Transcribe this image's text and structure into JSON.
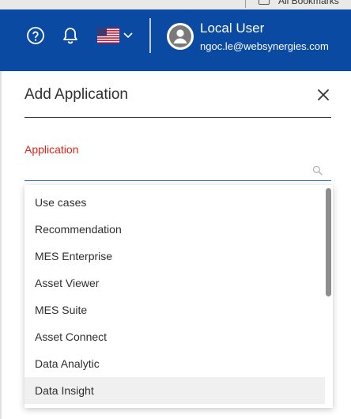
{
  "browser": {
    "bookmarks_label": "All Bookmarks"
  },
  "header": {
    "background_color": "#0b4aa2",
    "icons": [
      "help-icon",
      "bell-icon",
      "us-flag-icon",
      "chevron-down-icon"
    ],
    "user": {
      "name": "Local User",
      "email": "ngoc.le@websynergies.com"
    }
  },
  "dialog": {
    "title": "Add Application",
    "close_icon": "close-icon",
    "field": {
      "label": "Application",
      "label_color": "#e0241b",
      "value": "",
      "placeholder": "",
      "icon": "search-icon"
    },
    "options": [
      {
        "label": "Use cases"
      },
      {
        "label": "Recommendation"
      },
      {
        "label": "MES Enterprise"
      },
      {
        "label": "Asset Viewer"
      },
      {
        "label": "MES Suite"
      },
      {
        "label": "Asset Connect"
      },
      {
        "label": "Data Analytic"
      },
      {
        "label": "Data Insight",
        "hovered": true
      }
    ]
  }
}
